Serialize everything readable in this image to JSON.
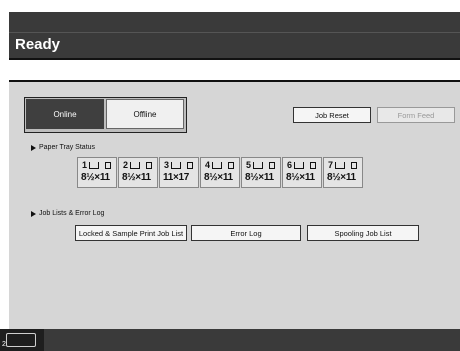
{
  "title": "Ready",
  "message": "",
  "mode": {
    "online_label": "Online",
    "offline_label": "Offline"
  },
  "actions": {
    "job_reset_label": "Job Reset",
    "form_feed_label": "Form Feed"
  },
  "paper_tray": {
    "label": "Paper Tray Status",
    "trays": [
      {
        "number": "1",
        "paper": "8½×11"
      },
      {
        "number": "2",
        "paper": "8½×11"
      },
      {
        "number": "3",
        "paper": "11×17"
      },
      {
        "number": "4",
        "paper": "8½×11"
      },
      {
        "number": "5",
        "paper": "8½×11"
      },
      {
        "number": "6",
        "paper": "8½×11"
      },
      {
        "number": "7",
        "paper": "8½×11"
      }
    ]
  },
  "job_lists": {
    "label": "Job Lists & Error Log",
    "locked_label": "Locked & Sample Print Job List",
    "error_label": "Error Log",
    "spooling_label": "Spooling Job List"
  },
  "corner_number": "2"
}
